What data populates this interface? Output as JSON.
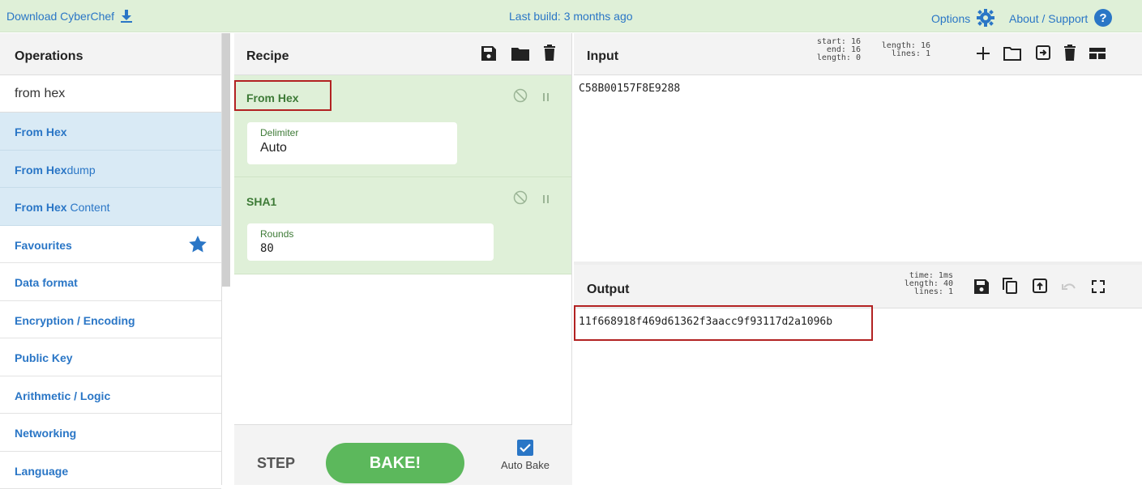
{
  "topbar": {
    "download": "Download CyberChef",
    "last_build": "Last build: 3 months ago",
    "options": "Options",
    "about": "About / Support"
  },
  "operations": {
    "title": "Operations",
    "search_value": "from hex",
    "results": [
      {
        "match": "From Hex",
        "rest": ""
      },
      {
        "match": "From Hex",
        "rest": "dump"
      },
      {
        "match": "From Hex",
        "rest": " Content"
      }
    ],
    "categories": [
      "Favourites",
      "Data format",
      "Encryption / Encoding",
      "Public Key",
      "Arithmetic / Logic",
      "Networking",
      "Language"
    ]
  },
  "recipe": {
    "title": "Recipe",
    "steps": [
      {
        "name": "From Hex",
        "arg_label": "Delimiter",
        "arg_value": "Auto"
      },
      {
        "name": "SHA1",
        "arg_label": "Rounds",
        "arg_value": "80"
      }
    ],
    "step_label": "STEP",
    "bake_label": "BAKE!",
    "auto_bake_label": "Auto Bake",
    "auto_bake_checked": true
  },
  "input": {
    "title": "Input",
    "stats_sel": [
      "start: 16",
      "end: 16",
      "length: 0"
    ],
    "stats": [
      "length: 16",
      "lines: 1"
    ],
    "value": "C58B00157F8E9288"
  },
  "output": {
    "title": "Output",
    "stats": [
      "time: 1ms",
      "length: 40",
      "lines: 1"
    ],
    "value": "11f668918f469d61362f3aacc9f93117d2a1096b"
  },
  "colors": {
    "accent": "#2a76c6",
    "recipe_bg": "#dff0d8",
    "bake": "#5cb85c",
    "highlight": "#b22222"
  }
}
